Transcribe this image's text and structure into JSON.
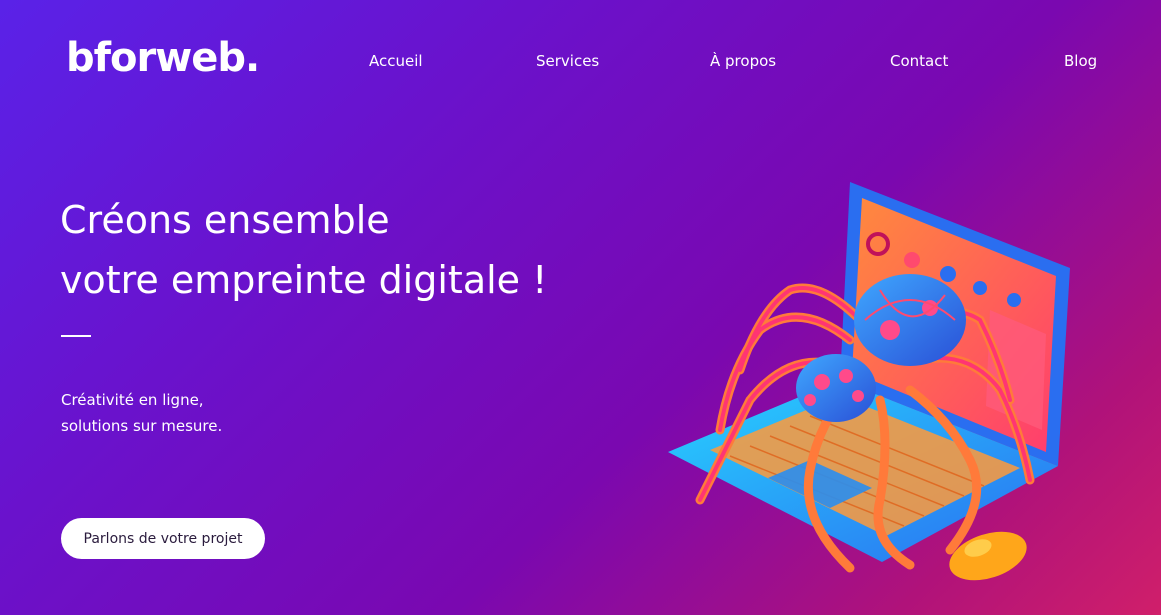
{
  "header": {
    "logo": "bforweb.",
    "nav": [
      {
        "label": "Accueil"
      },
      {
        "label": "Services"
      },
      {
        "label": "À propos"
      },
      {
        "label": "Contact"
      },
      {
        "label": "Blog"
      }
    ]
  },
  "hero": {
    "title_line1": "Créons ensemble",
    "title_line2": "votre empreinte digitale !",
    "subtitle_line1": "Créativité en ligne,",
    "subtitle_line2": "solutions sur mesure.",
    "cta": "Parlons de votre projet"
  },
  "colors": {
    "gradient_start": "#5a22e8",
    "gradient_end": "#d01f6a",
    "cta_bg": "#ffffff",
    "cta_text": "#2a1b3d"
  },
  "illustration": {
    "icon": "spider-on-laptop-illustration"
  }
}
